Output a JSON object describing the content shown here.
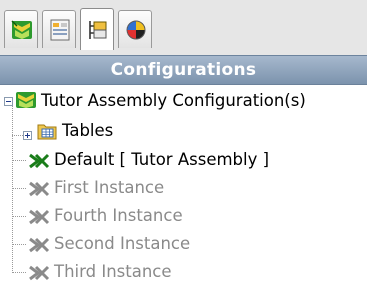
{
  "tabs": [
    {
      "name": "featuremanager-tab",
      "icon": "assembly-tree-icon",
      "active": false
    },
    {
      "name": "propertymanager-tab",
      "icon": "property-manager-icon",
      "active": false
    },
    {
      "name": "configurationmanager-tab",
      "icon": "configuration-manager-icon",
      "active": true
    },
    {
      "name": "displaymanager-tab",
      "icon": "display-manager-icon",
      "active": false
    }
  ],
  "panel": {
    "title": "Configurations"
  },
  "tree": {
    "root_label": "Tutor Assembly Configuration(s)",
    "tables_label": "Tables",
    "configurations": [
      {
        "label": "Default [ Tutor Assembly ]",
        "active": true
      },
      {
        "label": "First Instance",
        "active": false
      },
      {
        "label": "Fourth Instance",
        "active": false
      },
      {
        "label": "Second Instance",
        "active": false
      },
      {
        "label": "Third Instance",
        "active": false
      }
    ]
  },
  "colors": {
    "title_bar": "#8fa4bc",
    "active_config_icon": "#1a7d1a",
    "inactive_config_icon": "#8a8a8a",
    "dim_text": "#8a8a8a"
  }
}
